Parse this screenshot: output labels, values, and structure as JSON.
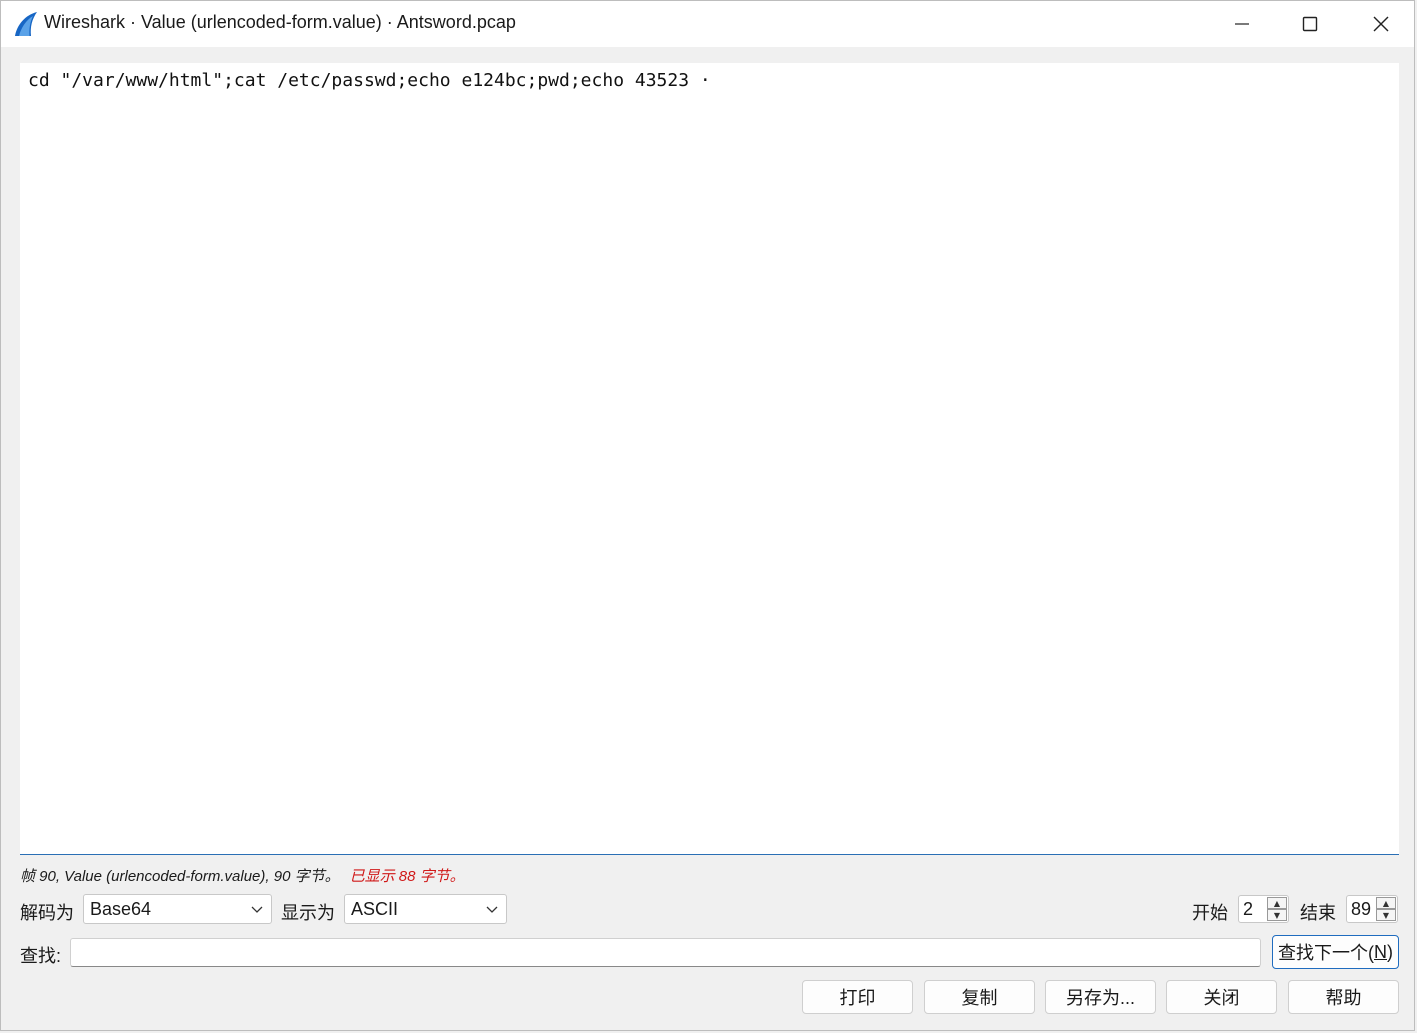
{
  "window": {
    "title": "Wireshark · Value (urlencoded-form.value) · Antsword.pcap",
    "controls": [
      "minimize",
      "maximize",
      "close"
    ]
  },
  "content": {
    "text": "cd \"/var/www/html\";cat /etc/passwd;echo e124bc;pwd;echo 43523 ·"
  },
  "status": {
    "info": "帧 90, Value (urlencoded-form.value), 90 字节。",
    "shown": "已显示 88 字节。"
  },
  "decode": {
    "label": "解码为",
    "value": "Base64"
  },
  "display": {
    "label": "显示为",
    "value": "ASCII"
  },
  "range": {
    "start_label": "开始",
    "start_value": "2",
    "end_label": "结束",
    "end_value": "89"
  },
  "find": {
    "label": "查找:",
    "value": "",
    "next_label_prefix": "查找下一个(",
    "next_label_key": "N",
    "next_label_suffix": ")"
  },
  "buttons": {
    "print": "打印",
    "copy": "复制",
    "save_as": "另存为...",
    "close": "关闭",
    "help": "帮助"
  },
  "colors": {
    "accent": "#1f6cbf",
    "warning_text": "#d01818"
  },
  "icons": {
    "app": "wireshark-fin-icon",
    "dropdown": "chevron-down-icon"
  }
}
